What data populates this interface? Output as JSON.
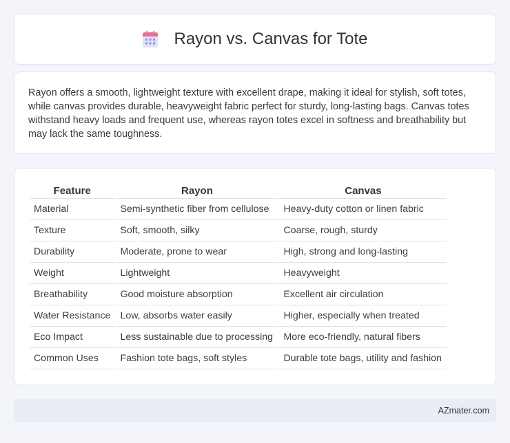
{
  "header": {
    "title": "Rayon vs. Canvas for Tote",
    "icon": "calendar-icon"
  },
  "intro": {
    "text": "Rayon offers a smooth, lightweight texture with excellent drape, making it ideal for stylish, soft totes, while canvas provides durable, heavyweight fabric perfect for sturdy, long-lasting bags. Canvas totes withstand heavy loads and frequent use, whereas rayon totes excel in softness and breathability but may lack the same toughness."
  },
  "table": {
    "headers": [
      "Feature",
      "Rayon",
      "Canvas"
    ],
    "rows": [
      [
        "Material",
        "Semi-synthetic fiber from cellulose",
        "Heavy-duty cotton or linen fabric"
      ],
      [
        "Texture",
        "Soft, smooth, silky",
        "Coarse, rough, sturdy"
      ],
      [
        "Durability",
        "Moderate, prone to wear",
        "High, strong and long-lasting"
      ],
      [
        "Weight",
        "Lightweight",
        "Heavyweight"
      ],
      [
        "Breathability",
        "Good moisture absorption",
        "Excellent air circulation"
      ],
      [
        "Water Resistance",
        "Low, absorbs water easily",
        "Higher, especially when treated"
      ],
      [
        "Eco Impact",
        "Less sustainable due to processing",
        "More eco-friendly, natural fibers"
      ],
      [
        "Common Uses",
        "Fashion tote bags, soft styles",
        "Durable tote bags, utility and fashion"
      ]
    ]
  },
  "footer": {
    "brand": "AZmater.com"
  },
  "colors": {
    "background": "#f3f5fa",
    "footer_bg": "#e8edf6",
    "icon_top": "#ef6b8a",
    "icon_body": "#d9dcf7",
    "icon_dots": "#7d86e0"
  }
}
